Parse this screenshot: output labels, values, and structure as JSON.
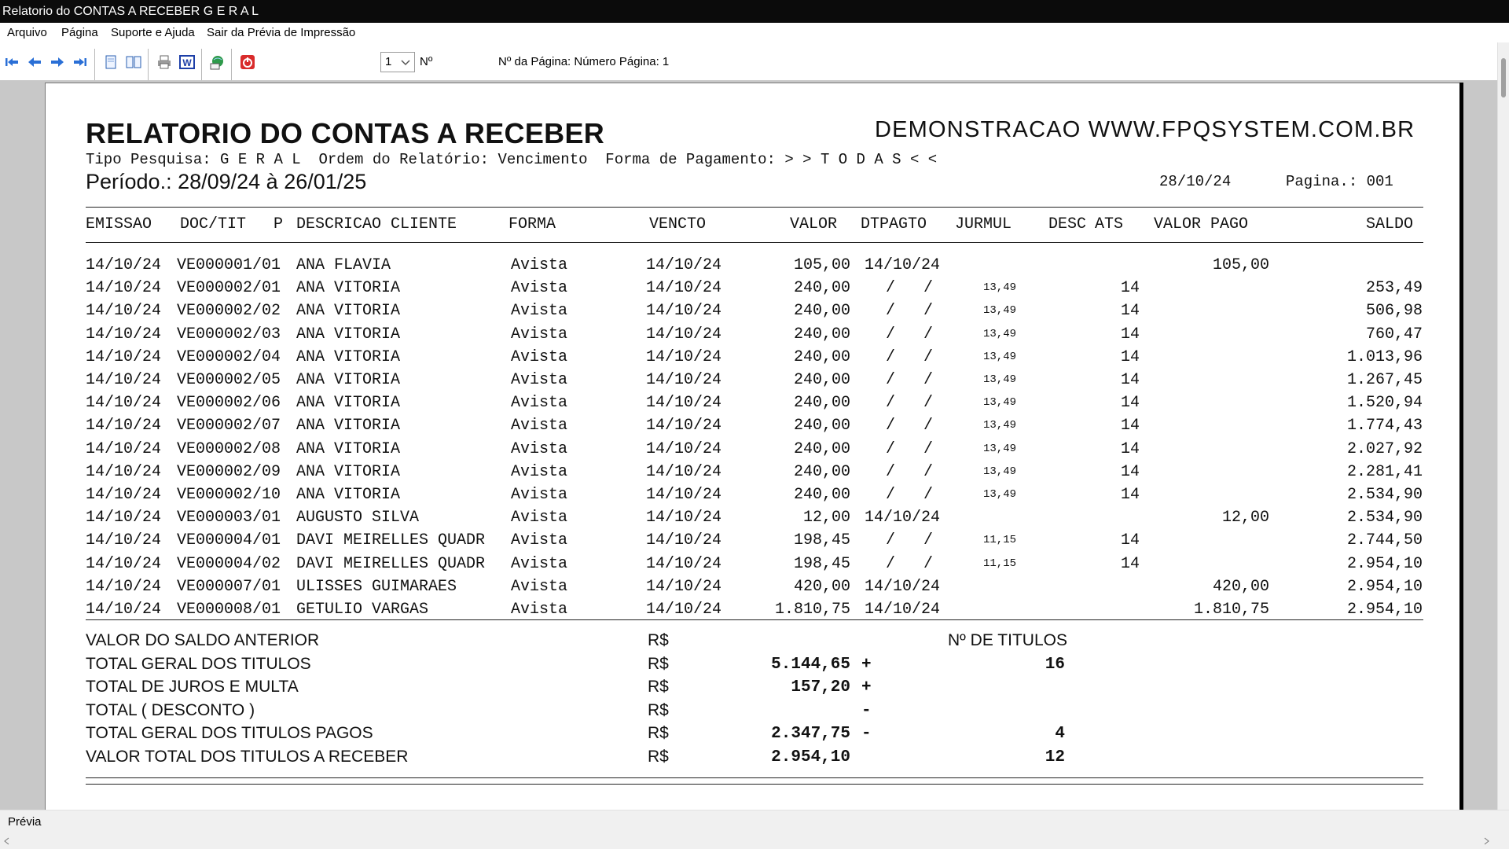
{
  "window": {
    "title": "Relatorio do CONTAS A RECEBER G E R A L"
  },
  "menu": [
    "Arquivo",
    "Página",
    "Suporte e Ajuda",
    "Sair da Prévia de Impressão"
  ],
  "toolbar": {
    "page_select_value": "1",
    "no_label": "Nº",
    "page_info": "Nº da Página: Número Página: 1"
  },
  "report": {
    "title": "RELATORIO DO CONTAS A RECEBER",
    "company": "DEMONSTRACAO WWW.FPQSYSTEM.COM.BR",
    "subtitle": "Tipo Pesquisa: G E R A L  Ordem do Relatório: Vencimento  Forma de Pagamento: > > T O D A S < <",
    "period": "Período.: 28/09/24 à 26/01/25",
    "date": "28/10/24",
    "page": "Pagina.: 001",
    "headers": {
      "emissao": "EMISSAO",
      "doc": "DOC/TIT",
      "p": "P",
      "cliente": "DESCRICAO CLIENTE",
      "forma": "FORMA",
      "vencto": "VENCTO",
      "valor": "VALOR",
      "dtpagto": "DTPAGTO",
      "jurmul": "JURMUL",
      "desc": "DESC",
      "ats": "ATS",
      "valor_pago": "VALOR PAGO",
      "saldo": "SALDO"
    },
    "rows": [
      {
        "emissao": "14/10/24",
        "doc": "VE000001/01",
        "cliente": "ANA FLAVIA",
        "forma": "Avista",
        "vencto": "14/10/24",
        "valor": "105,00",
        "dtpagto": "14/10/24",
        "jurmul": "",
        "ats": "",
        "pago": "105,00",
        "saldo": ""
      },
      {
        "emissao": "14/10/24",
        "doc": "VE000002/01",
        "cliente": "ANA VITORIA",
        "forma": "Avista",
        "vencto": "14/10/24",
        "valor": "240,00",
        "dtpagto": "/   /",
        "jurmul": "13,49",
        "ats": "14",
        "pago": "",
        "saldo": "253,49"
      },
      {
        "emissao": "14/10/24",
        "doc": "VE000002/02",
        "cliente": "ANA VITORIA",
        "forma": "Avista",
        "vencto": "14/10/24",
        "valor": "240,00",
        "dtpagto": "/   /",
        "jurmul": "13,49",
        "ats": "14",
        "pago": "",
        "saldo": "506,98"
      },
      {
        "emissao": "14/10/24",
        "doc": "VE000002/03",
        "cliente": "ANA VITORIA",
        "forma": "Avista",
        "vencto": "14/10/24",
        "valor": "240,00",
        "dtpagto": "/   /",
        "jurmul": "13,49",
        "ats": "14",
        "pago": "",
        "saldo": "760,47"
      },
      {
        "emissao": "14/10/24",
        "doc": "VE000002/04",
        "cliente": "ANA VITORIA",
        "forma": "Avista",
        "vencto": "14/10/24",
        "valor": "240,00",
        "dtpagto": "/   /",
        "jurmul": "13,49",
        "ats": "14",
        "pago": "",
        "saldo": "1.013,96"
      },
      {
        "emissao": "14/10/24",
        "doc": "VE000002/05",
        "cliente": "ANA VITORIA",
        "forma": "Avista",
        "vencto": "14/10/24",
        "valor": "240,00",
        "dtpagto": "/   /",
        "jurmul": "13,49",
        "ats": "14",
        "pago": "",
        "saldo": "1.267,45"
      },
      {
        "emissao": "14/10/24",
        "doc": "VE000002/06",
        "cliente": "ANA VITORIA",
        "forma": "Avista",
        "vencto": "14/10/24",
        "valor": "240,00",
        "dtpagto": "/   /",
        "jurmul": "13,49",
        "ats": "14",
        "pago": "",
        "saldo": "1.520,94"
      },
      {
        "emissao": "14/10/24",
        "doc": "VE000002/07",
        "cliente": "ANA VITORIA",
        "forma": "Avista",
        "vencto": "14/10/24",
        "valor": "240,00",
        "dtpagto": "/   /",
        "jurmul": "13,49",
        "ats": "14",
        "pago": "",
        "saldo": "1.774,43"
      },
      {
        "emissao": "14/10/24",
        "doc": "VE000002/08",
        "cliente": "ANA VITORIA",
        "forma": "Avista",
        "vencto": "14/10/24",
        "valor": "240,00",
        "dtpagto": "/   /",
        "jurmul": "13,49",
        "ats": "14",
        "pago": "",
        "saldo": "2.027,92"
      },
      {
        "emissao": "14/10/24",
        "doc": "VE000002/09",
        "cliente": "ANA VITORIA",
        "forma": "Avista",
        "vencto": "14/10/24",
        "valor": "240,00",
        "dtpagto": "/   /",
        "jurmul": "13,49",
        "ats": "14",
        "pago": "",
        "saldo": "2.281,41"
      },
      {
        "emissao": "14/10/24",
        "doc": "VE000002/10",
        "cliente": "ANA VITORIA",
        "forma": "Avista",
        "vencto": "14/10/24",
        "valor": "240,00",
        "dtpagto": "/   /",
        "jurmul": "13,49",
        "ats": "14",
        "pago": "",
        "saldo": "2.534,90"
      },
      {
        "emissao": "14/10/24",
        "doc": "VE000003/01",
        "cliente": "AUGUSTO SILVA",
        "forma": "Avista",
        "vencto": "14/10/24",
        "valor": "12,00",
        "dtpagto": "14/10/24",
        "jurmul": "",
        "ats": "",
        "pago": "12,00",
        "saldo": "2.534,90"
      },
      {
        "emissao": "14/10/24",
        "doc": "VE000004/01",
        "cliente": "DAVI MEIRELLES QUADR",
        "forma": "Avista",
        "vencto": "14/10/24",
        "valor": "198,45",
        "dtpagto": "/   /",
        "jurmul": "11,15",
        "ats": "14",
        "pago": "",
        "saldo": "2.744,50"
      },
      {
        "emissao": "14/10/24",
        "doc": "VE000004/02",
        "cliente": "DAVI MEIRELLES QUADR",
        "forma": "Avista",
        "vencto": "14/10/24",
        "valor": "198,45",
        "dtpagto": "/   /",
        "jurmul": "11,15",
        "ats": "14",
        "pago": "",
        "saldo": "2.954,10"
      },
      {
        "emissao": "14/10/24",
        "doc": "VE000007/01",
        "cliente": "ULISSES GUIMARAES",
        "forma": "Avista",
        "vencto": "14/10/24",
        "valor": "420,00",
        "dtpagto": "14/10/24",
        "jurmul": "",
        "ats": "",
        "pago": "420,00",
        "saldo": "2.954,10"
      },
      {
        "emissao": "14/10/24",
        "doc": "VE000008/01",
        "cliente": "GETULIO VARGAS",
        "forma": "Avista",
        "vencto": "14/10/24",
        "valor": "1.810,75",
        "dtpagto": "14/10/24",
        "jurmul": "",
        "ats": "",
        "pago": "1.810,75",
        "saldo": "2.954,10"
      }
    ],
    "summary": {
      "no_titulos_label": "Nº DE TITULOS",
      "currency": "R$",
      "lines": [
        {
          "label": "VALOR DO SALDO ANTERIOR",
          "value": "",
          "sign": "",
          "count": ""
        },
        {
          "label": "TOTAL GERAL DOS TITULOS",
          "value": "5.144,65",
          "sign": "+",
          "count": "16"
        },
        {
          "label": "TOTAL DE JUROS E MULTA",
          "value": "157,20",
          "sign": "+",
          "count": ""
        },
        {
          "label": "TOTAL ( DESCONTO )",
          "value": "",
          "sign": "-",
          "count": ""
        },
        {
          "label": "TOTAL GERAL DOS TITULOS PAGOS",
          "value": "2.347,75",
          "sign": "-",
          "count": "4"
        },
        {
          "label": "VALOR TOTAL DOS TITULOS A RECEBER",
          "value": "2.954,10",
          "sign": "",
          "count": "12"
        }
      ]
    }
  },
  "status": {
    "text": "Prévia"
  }
}
